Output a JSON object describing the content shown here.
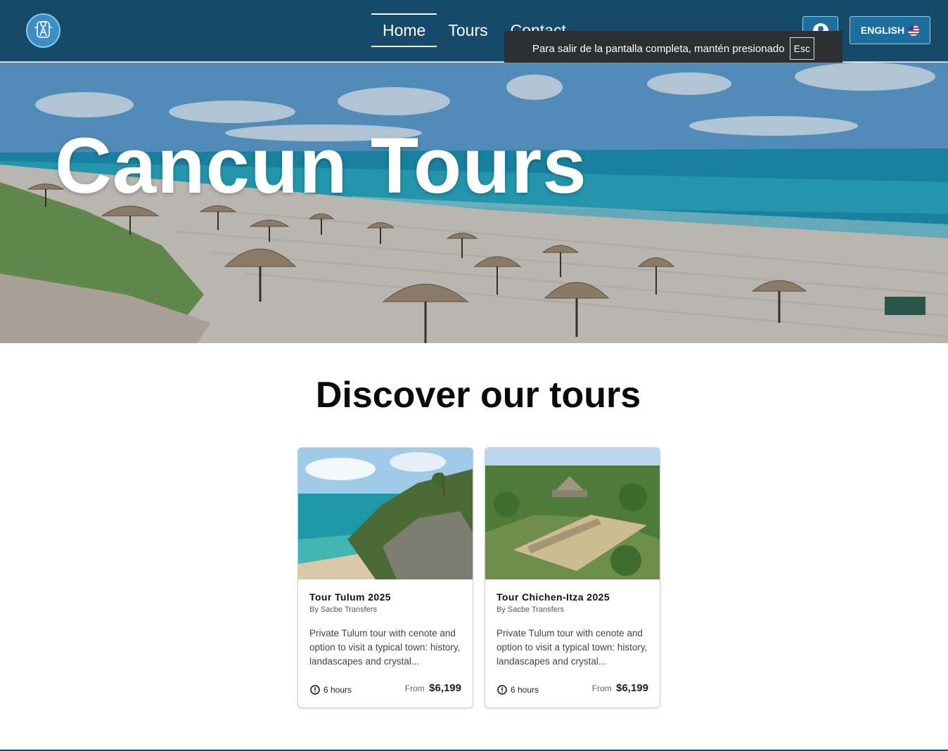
{
  "header": {
    "nav": [
      {
        "label": "Home",
        "active": true
      },
      {
        "label": "Tours",
        "active": false
      },
      {
        "label": "Contact",
        "active": false
      }
    ],
    "language_label": "ENGLISH",
    "language_flag": "us-flag-icon",
    "user_icon": "user-icon",
    "logo_icon": "logo-icon",
    "brand_color": "#154a6b"
  },
  "fullscreen_toast": {
    "message": "Para salir de la pantalla completa, mantén presionado",
    "key": "Esc"
  },
  "hero": {
    "title": "Cancun Tours"
  },
  "discover": {
    "title": "Discover our tours",
    "cards": [
      {
        "title": "Tour Tulum 2025",
        "byline": "By Sacbe Transfers",
        "description": "Private Tulum tour with cenote and option to visit a typical town: history, landascapes and crystal...",
        "duration": "6 hours",
        "price_prefix": "From",
        "price": "$6,199"
      },
      {
        "title": "Tour Chichen-Itza 2025",
        "byline": "By Sacbe Transfers",
        "description": "Private Tulum tour with cenote and option to visit a typical town: history, landascapes and crystal...",
        "duration": "6 hours",
        "price_prefix": "From",
        "price": "$6,199"
      }
    ]
  }
}
